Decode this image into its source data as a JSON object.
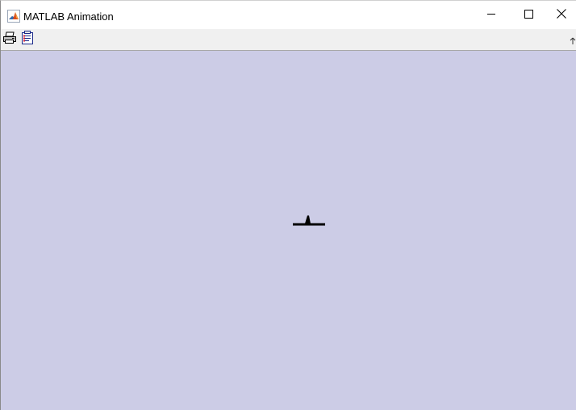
{
  "window": {
    "title": "MATLAB Animation"
  },
  "icons": {
    "app": "matlab-logo-icon",
    "minimize": "minimize-icon",
    "maximize": "maximize-icon",
    "close": "close-icon",
    "print": "print-icon",
    "properties": "property-editor-icon",
    "overflow": "toolbar-overflow-icon"
  },
  "colors": {
    "figure_background": "#cccce6",
    "toolbar_background": "#f0f0f0",
    "aircraft": "#000000"
  }
}
